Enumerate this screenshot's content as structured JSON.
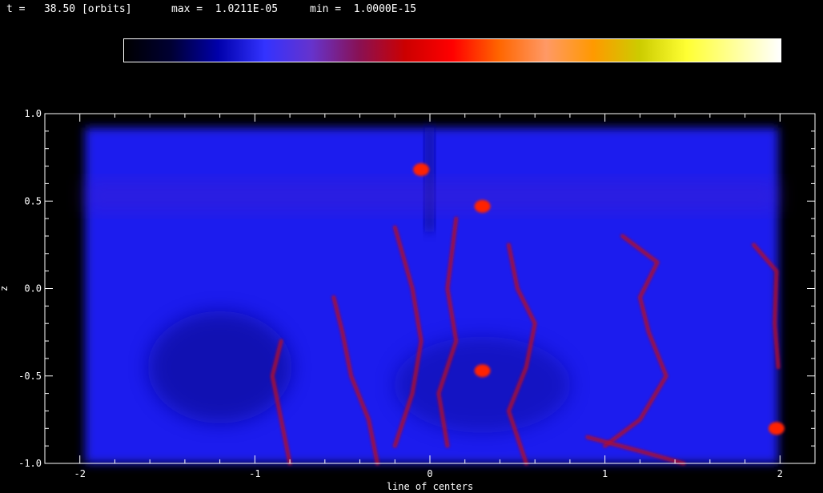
{
  "header": {
    "time_label": "t =",
    "time_value": "38.50",
    "time_unit": "[orbits]",
    "max_label": "max =",
    "max_value": "1.0211E-05",
    "min_label": "min =",
    "min_value": "1.0000E-15"
  },
  "colorbar": {
    "stops": [
      "#000000",
      "#000033",
      "#0000aa",
      "#3333ff",
      "#6633cc",
      "#881155",
      "#cc0000",
      "#ff0000",
      "#ff6600",
      "#ff9966",
      "#ff9900",
      "#cccc00",
      "#ffff33",
      "#ffff99",
      "#ffffff"
    ]
  },
  "chart_data": {
    "type": "heatmap",
    "xlabel": "line of centers",
    "ylabel": "z",
    "xlim": [
      -2.2,
      2.2
    ],
    "ylim": [
      -1.0,
      1.0
    ],
    "x_ticks": [
      -2,
      -1,
      0,
      1,
      2
    ],
    "x_tick_labels": [
      "-2",
      "-1",
      "0",
      "1",
      "2"
    ],
    "y_ticks": [
      -1.0,
      -0.5,
      0.0,
      0.5,
      1.0
    ],
    "y_tick_labels": [
      "-1.0",
      "-0.5",
      "0.0",
      "0.5",
      "1.0"
    ],
    "colors": {
      "background_field": "#1a1aee",
      "dark_field": "#10109a",
      "filament": "#aa1133",
      "hot": "#ff2200"
    },
    "filaments": [
      {
        "points": [
          [
            -0.55,
            -0.05
          ],
          [
            -0.5,
            -0.25
          ],
          [
            -0.45,
            -0.5
          ],
          [
            -0.35,
            -0.75
          ],
          [
            -0.3,
            -1.0
          ]
        ]
      },
      {
        "points": [
          [
            -0.85,
            -0.3
          ],
          [
            -0.9,
            -0.5
          ],
          [
            -0.85,
            -0.75
          ],
          [
            -0.8,
            -1.0
          ]
        ]
      },
      {
        "points": [
          [
            0.45,
            0.25
          ],
          [
            0.5,
            0.0
          ],
          [
            0.6,
            -0.2
          ],
          [
            0.55,
            -0.45
          ],
          [
            0.45,
            -0.7
          ],
          [
            0.55,
            -1.0
          ]
        ]
      },
      {
        "points": [
          [
            1.1,
            0.3
          ],
          [
            1.3,
            0.15
          ],
          [
            1.2,
            -0.05
          ],
          [
            1.25,
            -0.25
          ],
          [
            1.35,
            -0.5
          ],
          [
            1.2,
            -0.75
          ],
          [
            1.0,
            -0.9
          ]
        ]
      },
      {
        "points": [
          [
            1.85,
            0.25
          ],
          [
            1.98,
            0.1
          ],
          [
            1.97,
            -0.2
          ],
          [
            1.99,
            -0.45
          ]
        ]
      },
      {
        "points": [
          [
            0.9,
            -0.85
          ],
          [
            1.2,
            -0.93
          ],
          [
            1.45,
            -1.0
          ]
        ]
      },
      {
        "points": [
          [
            -0.2,
            0.35
          ],
          [
            -0.1,
            0.0
          ],
          [
            -0.05,
            -0.3
          ],
          [
            -0.1,
            -0.6
          ],
          [
            -0.2,
            -0.9
          ]
        ]
      },
      {
        "points": [
          [
            0.15,
            0.4
          ],
          [
            0.1,
            0.0
          ],
          [
            0.15,
            -0.3
          ],
          [
            0.05,
            -0.6
          ],
          [
            0.1,
            -0.9
          ]
        ]
      }
    ],
    "hot_spots": [
      {
        "x": 0.3,
        "y": 0.47
      },
      {
        "x": 0.3,
        "y": -0.47
      },
      {
        "x": -0.05,
        "y": 0.68
      },
      {
        "x": 1.98,
        "y": -0.8
      }
    ]
  }
}
